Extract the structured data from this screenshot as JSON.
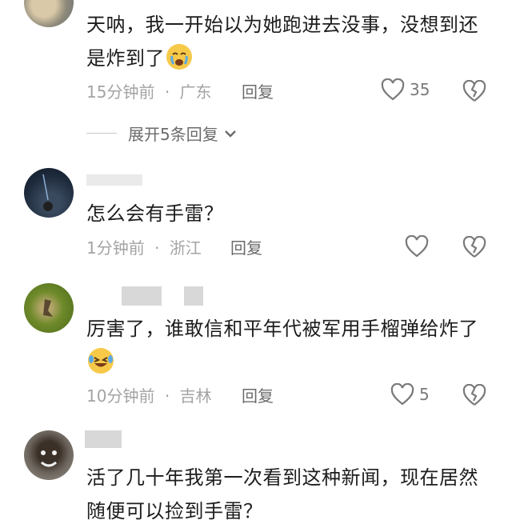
{
  "comments": [
    {
      "text": "天呐，我一开始以为她跑进去没事，没想到还是炸到了",
      "emoji": "crying-face",
      "time": "15分钟前",
      "location": "广东",
      "reply_label": "回复",
      "likes": "35",
      "expand_label": "展开5条回复"
    },
    {
      "text": "怎么会有手雷？",
      "time": "1分钟前",
      "location": "浙江",
      "reply_label": "回复",
      "likes": ""
    },
    {
      "text": "厉害了，谁敢信和平年代被军用手榴弹给炸了",
      "emoji": "laughing-crying-face",
      "time": "10分钟前",
      "location": "吉林",
      "reply_label": "回复",
      "likes": "5"
    },
    {
      "text": "活了几十年我第一次看到这种新闻，现在居然随便可以捡到手雷？"
    }
  ],
  "separator": "·",
  "colors": {
    "text": "#1d1d1d",
    "meta": "#a3a3a3",
    "icon": "#7a7a7a",
    "emoji_yellow": "#f7c948"
  }
}
